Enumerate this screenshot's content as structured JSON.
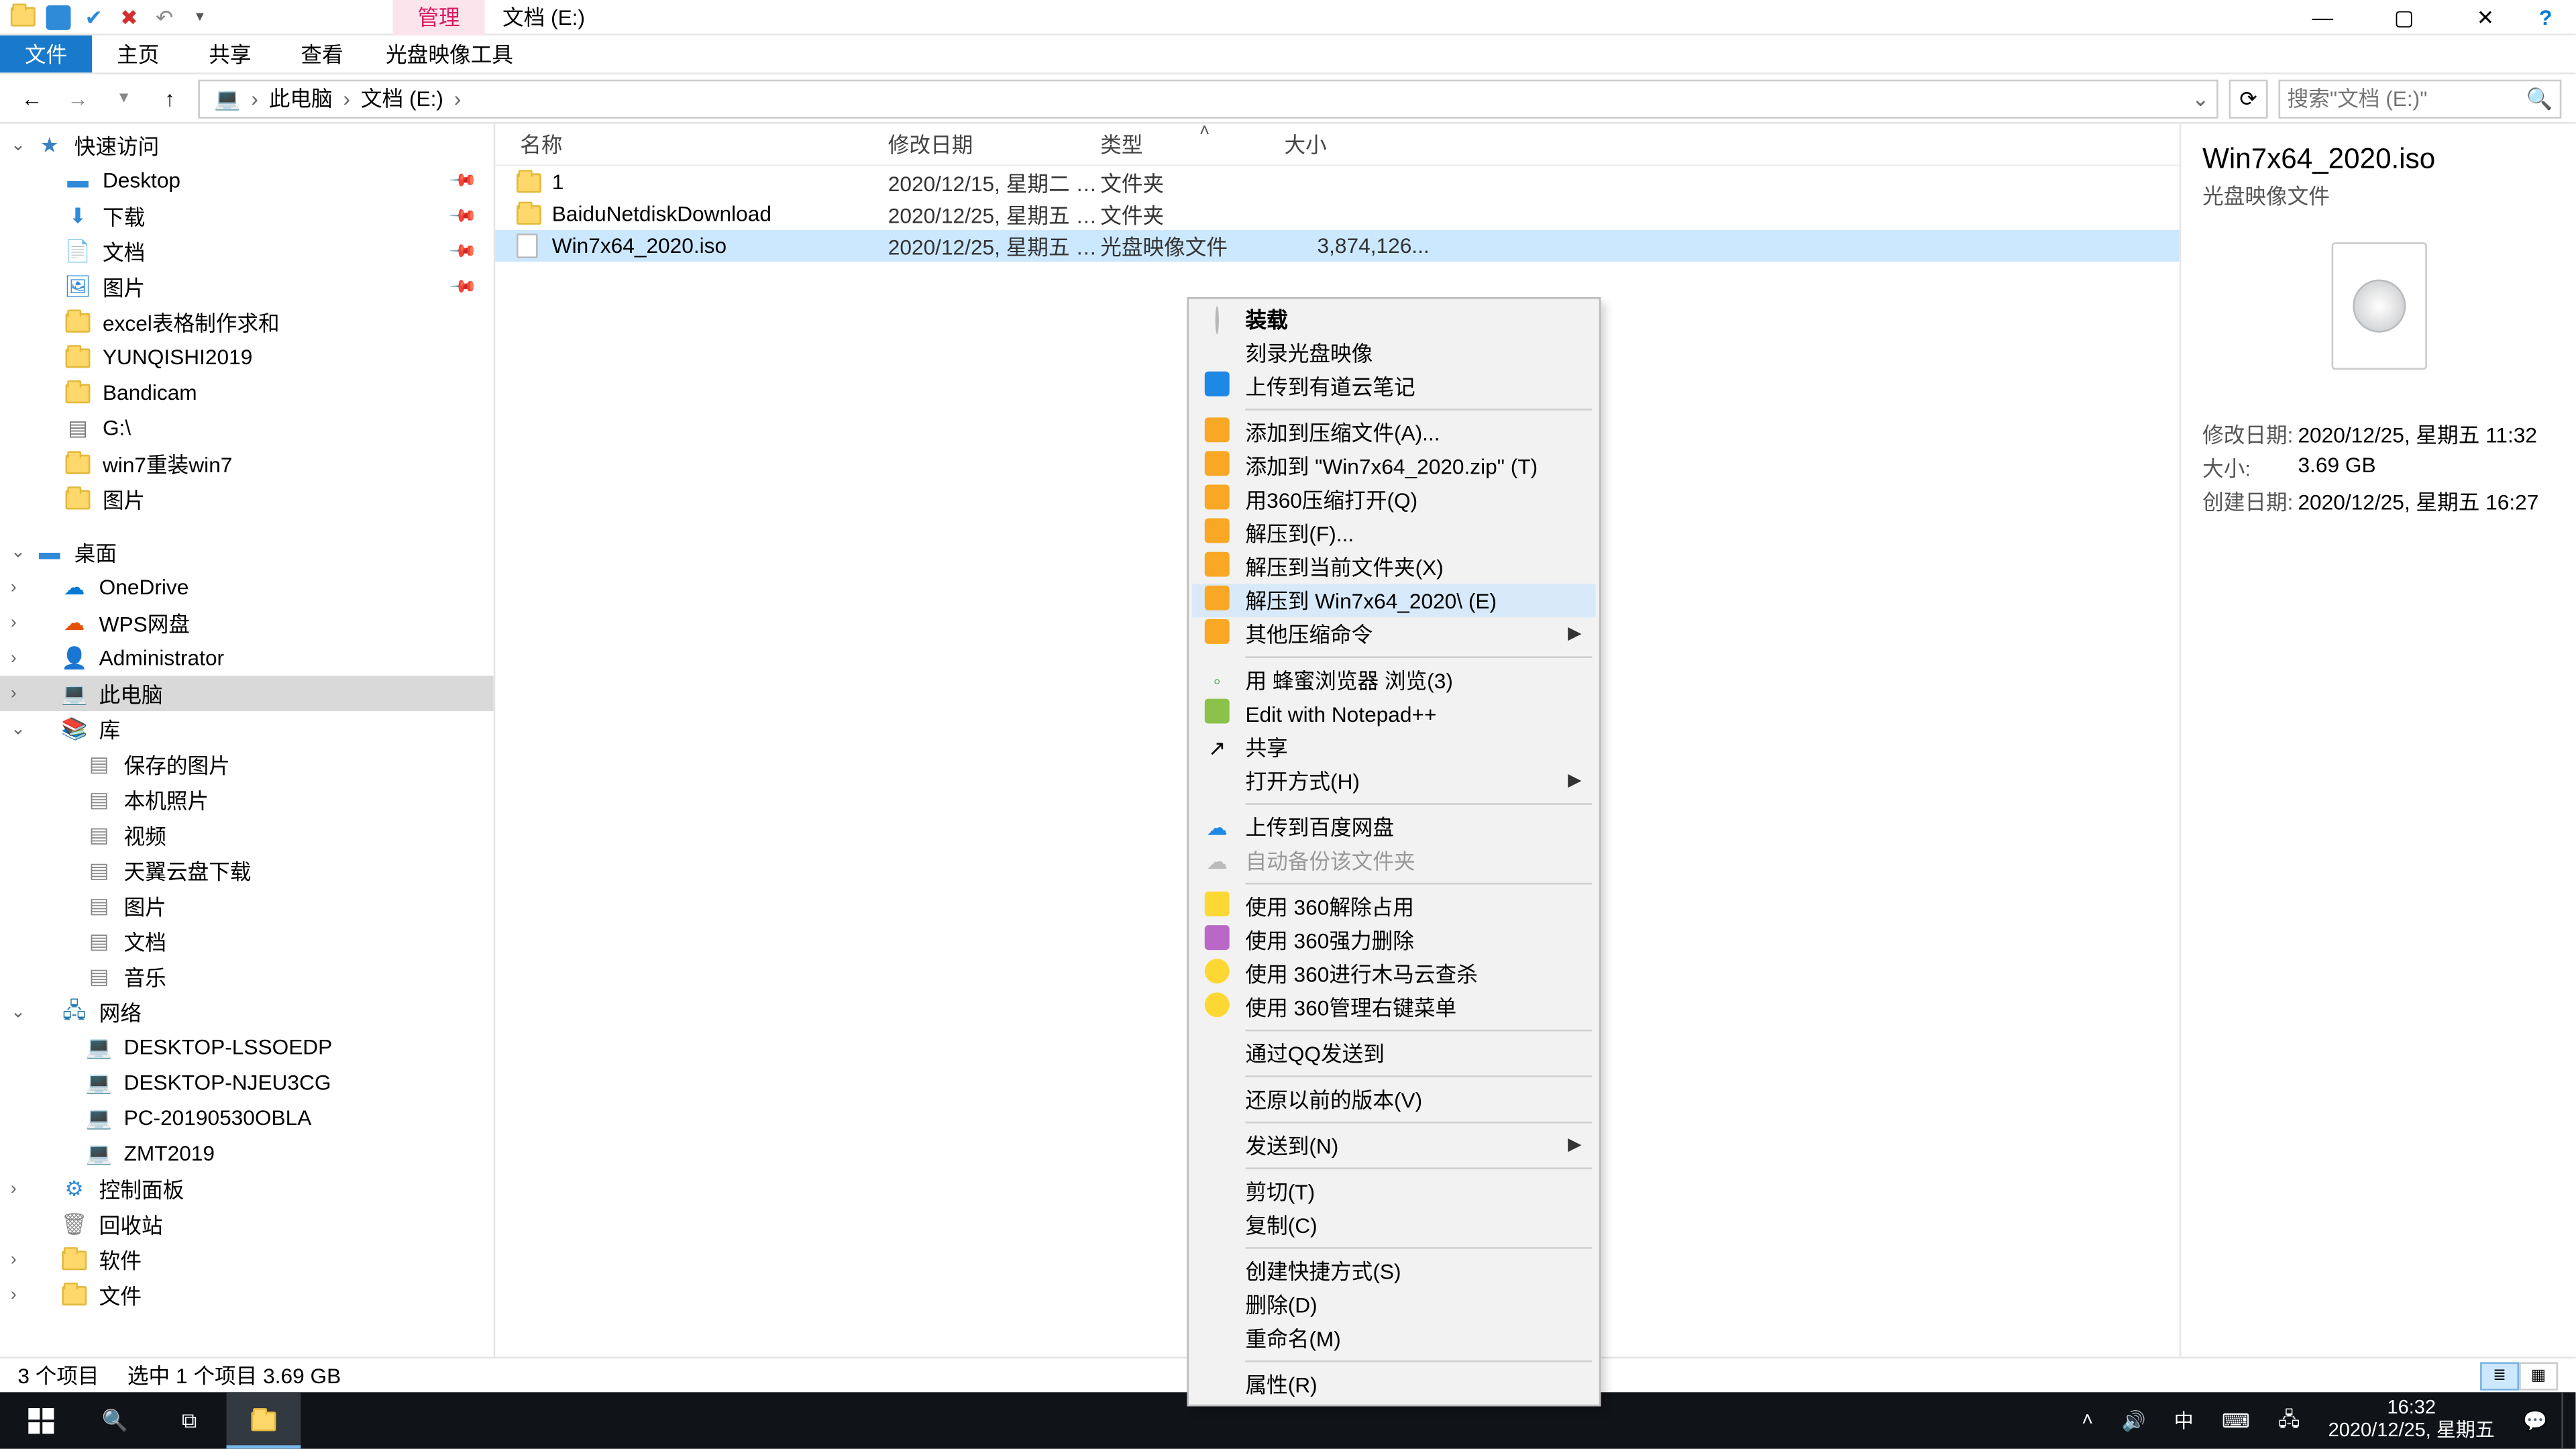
{
  "titlebar": {
    "manage_tab": "管理",
    "location": "文档 (E:)"
  },
  "ribbon": {
    "file": "文件",
    "home": "主页",
    "share": "共享",
    "view": "查看",
    "disc_tools": "光盘映像工具"
  },
  "nav": {
    "this_pc": "此电脑",
    "docs_e": "文档 (E:)",
    "search_placeholder": "搜索\"文档 (E:)\""
  },
  "tree": {
    "quick_access": "快速访问",
    "desktop": "Desktop",
    "downloads": "下载",
    "documents": "文档",
    "pictures": "图片",
    "excel": "excel表格制作求和",
    "yunqishi": "YUNQISHI2019",
    "bandicam": "Bandicam",
    "g_drive": "G:\\",
    "win7_reinstall": "win7重装win7",
    "pictures2": "图片",
    "desktop_cn": "桌面",
    "onedrive": "OneDrive",
    "wps": "WPS网盘",
    "admin": "Administrator",
    "this_pc": "此电脑",
    "libraries": "库",
    "saved_pictures": "保存的图片",
    "camera_roll": "本机照片",
    "videos": "视频",
    "skycloud": "天翼云盘下载",
    "lib_pictures": "图片",
    "lib_docs": "文档",
    "lib_music": "音乐",
    "network": "网络",
    "pc1": "DESKTOP-LSSOEDP",
    "pc2": "DESKTOP-NJEU3CG",
    "pc3": "PC-20190530OBLA",
    "pc4": "ZMT2019",
    "control_panel": "控制面板",
    "recycle": "回收站",
    "software": "软件",
    "files": "文件"
  },
  "columns": {
    "name": "名称",
    "date": "修改日期",
    "type": "类型",
    "size": "大小"
  },
  "rows": [
    {
      "name": "1",
      "date": "2020/12/15, 星期二 1...",
      "type": "文件夹",
      "size": ""
    },
    {
      "name": "BaiduNetdiskDownload",
      "date": "2020/12/25, 星期五 1...",
      "type": "文件夹",
      "size": ""
    },
    {
      "name": "Win7x64_2020.iso",
      "date": "2020/12/25, 星期五 1...",
      "type": "光盘映像文件",
      "size": "3,874,126..."
    }
  ],
  "details": {
    "title": "Win7x64_2020.iso",
    "subtitle": "光盘映像文件",
    "k_moddate": "修改日期:",
    "v_moddate": "2020/12/25, 星期五 11:32",
    "k_size": "大小:",
    "v_size": "3.69 GB",
    "k_created": "创建日期:",
    "v_created": "2020/12/25, 星期五 16:27"
  },
  "status": {
    "count": "3 个项目",
    "selection": "选中 1 个项目  3.69 GB"
  },
  "taskbar": {
    "time": "16:32",
    "date": "2020/12/25, 星期五",
    "ime": "中"
  },
  "ctx": {
    "mount": "装载",
    "burn": "刻录光盘映像",
    "youdao": "上传到有道云笔记",
    "add_archive": "添加到压缩文件(A)...",
    "add_zip": "添加到 \"Win7x64_2020.zip\" (T)",
    "open_360zip": "用360压缩打开(Q)",
    "extract_to": "解压到(F)...",
    "extract_here": "解压到当前文件夹(X)",
    "extract_named": "解压到 Win7x64_2020\\ (E)",
    "other_compress": "其他压缩命令",
    "honey_browser": "用 蜂蜜浏览器 浏览(3)",
    "notepadpp": "Edit with Notepad++",
    "share": "共享",
    "open_with": "打开方式(H)",
    "baidu_upload": "上传到百度网盘",
    "auto_backup": "自动备份该文件夹",
    "unlock_360": "使用 360解除占用",
    "force_del_360": "使用 360强力删除",
    "trojan_360": "使用 360进行木马云查杀",
    "manage_menu_360": "使用 360管理右键菜单",
    "qq_send": "通过QQ发送到",
    "restore_prev": "还原以前的版本(V)",
    "send_to": "发送到(N)",
    "cut": "剪切(T)",
    "copy": "复制(C)",
    "create_shortcut": "创建快捷方式(S)",
    "delete": "删除(D)",
    "rename": "重命名(M)",
    "properties": "属性(R)"
  }
}
